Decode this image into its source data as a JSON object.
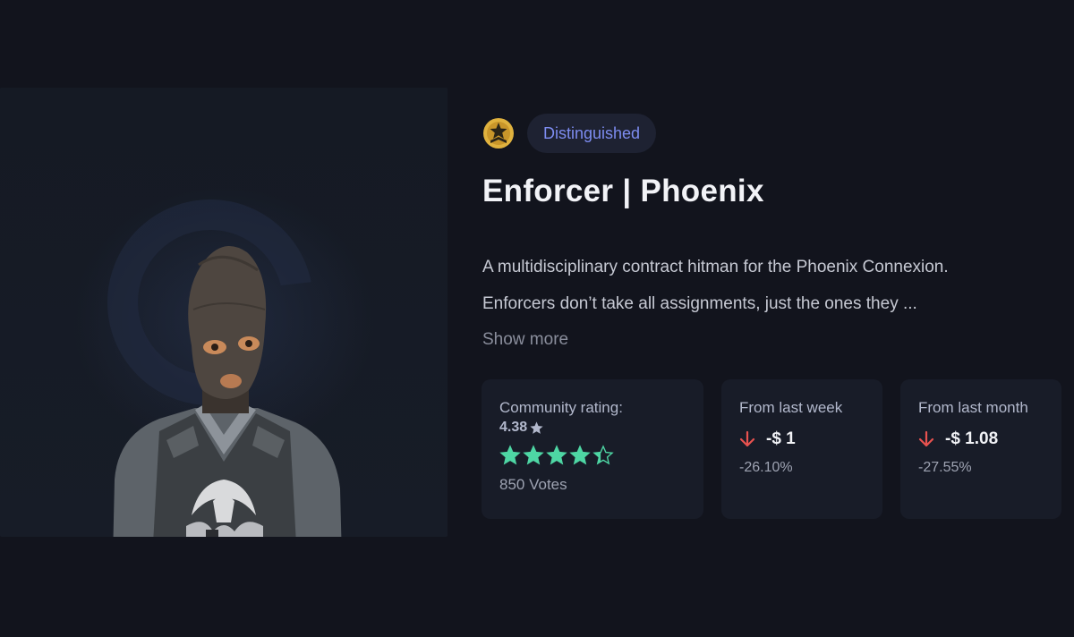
{
  "item": {
    "rarity": "Distinguished",
    "rarity_icon": "rank-star-icon",
    "title": "Enforcer | Phoenix",
    "description_line1": "A multidisciplinary contract hitman for the Phoenix Connexion.",
    "description_line2": "Enforcers don’t take all assignments, just the ones they ...",
    "show_more_label": "Show more",
    "image_icon": "agent-portrait"
  },
  "rating_card": {
    "label": "Community rating:",
    "value": "4.38",
    "value_icon": "star-icon",
    "stars_filled_fraction": 0.876,
    "stars_total": 5,
    "votes": "850 Votes",
    "star_color": "#4ed6a4"
  },
  "week_card": {
    "label": "From last week",
    "arrow_icon": "arrow-down-icon",
    "price_change": "-$ 1",
    "percent_change": "-26.10%",
    "arrow_color": "#e8524f"
  },
  "month_card": {
    "label": "From last month",
    "arrow_icon": "arrow-down-icon",
    "price_change": "-$ 1.08",
    "percent_change": "-27.55%",
    "arrow_color": "#e8524f"
  },
  "colors": {
    "background": "#12141d",
    "card": "#181c28",
    "badge_text": "#7d8cf0"
  }
}
